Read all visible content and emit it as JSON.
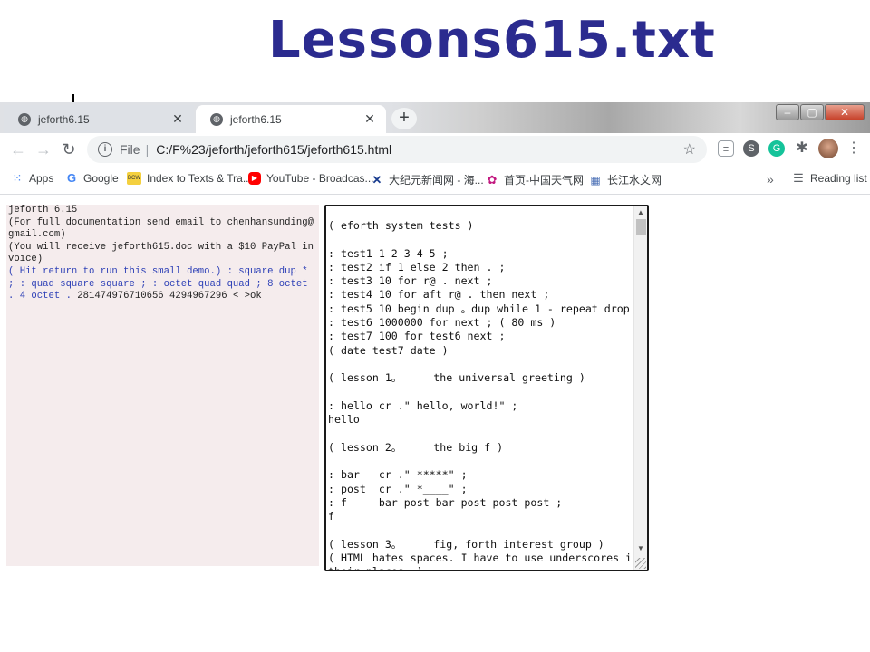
{
  "slide": {
    "title": "Lessons615.txt"
  },
  "browser": {
    "tabs": [
      {
        "label": "jeforth6.15",
        "active": false
      },
      {
        "label": "jeforth6.15",
        "active": true
      }
    ],
    "new_tab_symbol": "+",
    "window_controls": {
      "minimize": "‒",
      "maximize": "▢",
      "close": "✕"
    },
    "address_bar": {
      "scheme": "File",
      "separator": "|",
      "url": "C:/F%23/jeforth/jeforth615/jeforth615.html"
    },
    "bookmarks": [
      {
        "label": "Apps",
        "icon": "apps-grid-icon"
      },
      {
        "label": "Google",
        "icon": "google-icon"
      },
      {
        "label": "Index to Texts & Tra...",
        "icon": "bcw-icon"
      },
      {
        "label": "YouTube - Broadcas...",
        "icon": "youtube-icon"
      },
      {
        "label": "大纪元新闻网 - 海...",
        "icon": "dajiyuan-icon"
      },
      {
        "label": "首页-中国天气网",
        "icon": "weather-icon"
      },
      {
        "label": "长江水文网",
        "icon": "water-icon"
      }
    ],
    "bookmarks_more": "»",
    "reading_list": "Reading list"
  },
  "console": {
    "output": "jeforth 6.15\n(For full documentation send email to chenhansunding@gmail.com)\n(You will receive jeforth615.doc with a $10 PayPal invoice)\n",
    "input_echo": "( Hit return to run this small demo.) : square dup * ; : quad square square ; : octet quad quad ; 8 octet . 4 octet . ",
    "result": "281474976710656 4294967296 < >ok"
  },
  "source_text": "( eforth system tests )\n\n: test1 1 2 3 4 5 ;\n: test2 if 1 else 2 then . ;\n: test3 10 for r@ . next ;\n: test4 10 for aft r@ . then next ;\n: test5 10 begin dup 。dup while 1 - repeat drop ;\n: test6 1000000 for next ; ( 80 ms )\n: test7 100 for test6 next ;\n( date test7 date )\n\n( lesson 1。     the universal greeting )\n\n: hello cr .\" hello, world!\" ;\nhello\n\n( lesson 2。     the big f )\n\n: bar   cr .\" *****\" ;\n: post  cr .\" *____\" ;\n: f     bar post bar post post post ;\nf\n\n( lesson 3。     fig, forth interest group )\n( HTML hates spaces. I have to use underscores in\ntheir places. )"
}
